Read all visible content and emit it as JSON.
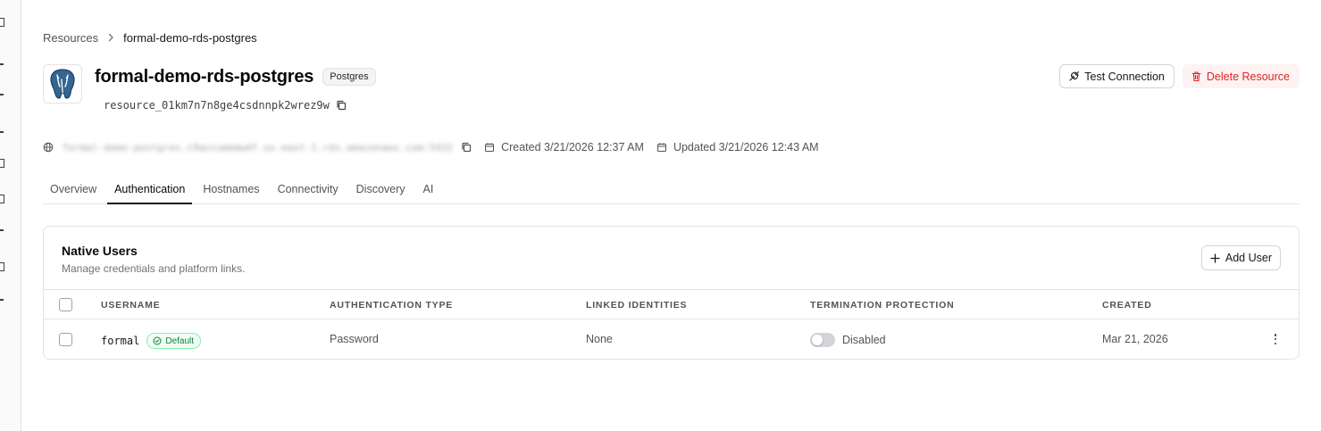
{
  "breadcrumb": {
    "root": "Resources",
    "current": "formal-demo-rds-postgres"
  },
  "resource": {
    "name": "formal-demo-rds-postgres",
    "engine_badge": "Postgres",
    "id": "resource_01km7n7n8ge4csdnnpk2wrez9w",
    "hostname": "formal-demo-postgres.c9qviumemwdf.us-east-1.rds.amazonaws.com:5432",
    "created": "Created 3/21/2026 12:37 AM",
    "updated": "Updated 3/21/2026 12:43 AM"
  },
  "actions": {
    "test_connection": "Test Connection",
    "delete_resource": "Delete Resource"
  },
  "tabs": [
    {
      "label": "Overview",
      "active": false
    },
    {
      "label": "Authentication",
      "active": true
    },
    {
      "label": "Hostnames",
      "active": false
    },
    {
      "label": "Connectivity",
      "active": false
    },
    {
      "label": "Discovery",
      "active": false
    },
    {
      "label": "AI",
      "active": false
    }
  ],
  "native_users": {
    "title": "Native Users",
    "subtitle": "Manage credentials and platform links.",
    "add_button": "Add User",
    "columns": {
      "username": "USERNAME",
      "auth_type": "AUTHENTICATION TYPE",
      "linked": "LINKED IDENTITIES",
      "termination": "TERMINATION PROTECTION",
      "created": "CREATED"
    },
    "rows": [
      {
        "username": "formal",
        "badge": "Default",
        "auth_type": "Password",
        "linked": "None",
        "termination": "Disabled",
        "termination_enabled": false,
        "created": "Mar 21, 2026"
      }
    ]
  },
  "colors": {
    "accent": "#18181b",
    "danger": "#dc2626",
    "danger_bg": "#fef2f2",
    "success": "#15803d"
  },
  "icons": [
    "postgres-elephant-icon",
    "copy-icon",
    "globe-icon",
    "calendar-icon",
    "plug-icon",
    "trash-icon",
    "plus-icon",
    "check-circle-icon",
    "more-vertical-icon",
    "chevron-right-icon"
  ]
}
